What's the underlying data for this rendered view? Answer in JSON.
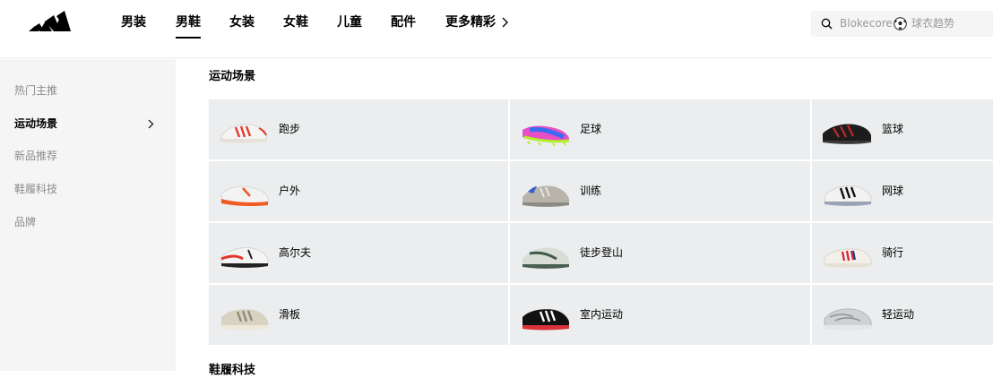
{
  "header": {
    "nav": [
      {
        "label": "男装"
      },
      {
        "label": "男鞋",
        "active": true
      },
      {
        "label": "女装"
      },
      {
        "label": "女鞋"
      },
      {
        "label": "儿童"
      },
      {
        "label": "配件"
      },
      {
        "label": "更多精彩"
      }
    ],
    "search": {
      "placeholder_left": "Blokecore",
      "placeholder_right": "球衣趋势"
    }
  },
  "sidebar": {
    "items": [
      {
        "label": "热门主推"
      },
      {
        "label": "运动场景",
        "active": true
      },
      {
        "label": "新品推荐"
      },
      {
        "label": "鞋履科技"
      },
      {
        "label": "品牌"
      }
    ]
  },
  "main": {
    "section_title": "运动场景",
    "tiles": [
      {
        "label": "跑步",
        "icon": "shoe-white-red"
      },
      {
        "label": "足球",
        "icon": "boot-pink-green"
      },
      {
        "label": "篮球",
        "icon": "shoe-black-red"
      },
      {
        "label": "户外",
        "icon": "shoe-white-orange"
      },
      {
        "label": "训练",
        "icon": "shoe-grey-blue"
      },
      {
        "label": "网球",
        "icon": "shoe-white-black"
      },
      {
        "label": "高尔夫",
        "icon": "shoe-white-red-golf"
      },
      {
        "label": "徒步登山",
        "icon": "shoe-green-grey"
      },
      {
        "label": "骑行",
        "icon": "shoe-white-red-stripes"
      },
      {
        "label": "滑板",
        "icon": "shoe-beige-skate"
      },
      {
        "label": "室内运动",
        "icon": "shoe-black-white"
      },
      {
        "label": "轻运动",
        "icon": "shoe-silver"
      }
    ],
    "next_section_title": "鞋履科技"
  },
  "colors": {
    "tile_bg": "#ebedee",
    "sidebar_bg": "#f5f5f5",
    "search_bg": "#f5f5f5"
  }
}
